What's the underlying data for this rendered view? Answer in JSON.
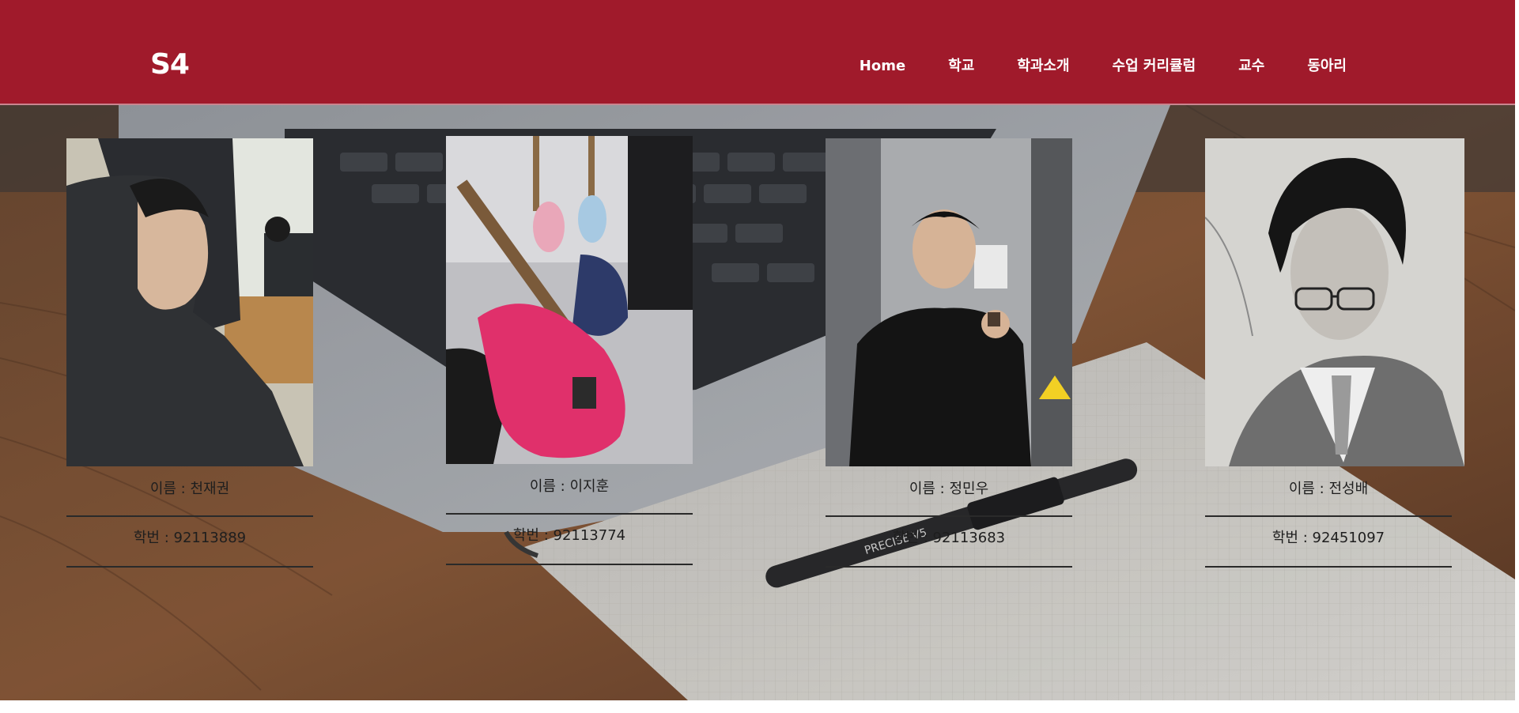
{
  "header": {
    "logo": "S4",
    "nav": [
      "Home",
      "학교",
      "학과소개",
      "수업 커리큘럼",
      "교수",
      "동아리"
    ]
  },
  "members": [
    {
      "name": "이름 : 천재권",
      "id": "학번 : 92113889"
    },
    {
      "name": "이름 : 이지훈",
      "id": "학번 : 92113774"
    },
    {
      "name": "이름 : 정민우",
      "id": "학번 : 92113683"
    },
    {
      "name": "이름 : 전성배",
      "id": "학번 : 92451097"
    }
  ],
  "colors": {
    "header_bg": "#a01a2b",
    "header_text": "#ffffff",
    "body_text": "#1e1e1e"
  },
  "icons": {
    "photo_1": "person-in-hood-photo",
    "photo_2": "guitar-photo",
    "photo_3": "person-in-elevator-photo",
    "photo_4": "man-with-glasses-photo"
  }
}
